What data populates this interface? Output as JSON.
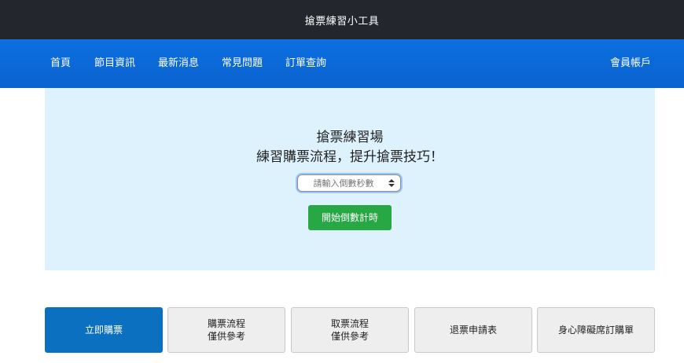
{
  "app": {
    "title": "搶票練習小工具"
  },
  "nav": {
    "items": [
      "首頁",
      "節目資訊",
      "最新消息",
      "常見問題",
      "訂單查詢"
    ],
    "account": "會員帳戶"
  },
  "hero": {
    "title_line1": "搶票練習場",
    "title_line2": "練習購票流程，提升搶票技巧！",
    "countdown_placeholder": "請輸入倒數秒數",
    "start_button": "開始倒數計時"
  },
  "actions": [
    {
      "lines": [
        "立即購票"
      ]
    },
    {
      "lines": [
        "購票流程",
        "僅供參考"
      ]
    },
    {
      "lines": [
        "取票流程",
        "僅供參考"
      ]
    },
    {
      "lines": [
        "退票申請表"
      ]
    },
    {
      "lines": [
        "身心障礙席訂購單"
      ]
    }
  ],
  "colors": {
    "topbar": "#23272d",
    "navbar": "#0d6fe0",
    "hero_bg": "#def2fd",
    "start_button": "#28a745",
    "primary_action": "#0b70c0"
  }
}
